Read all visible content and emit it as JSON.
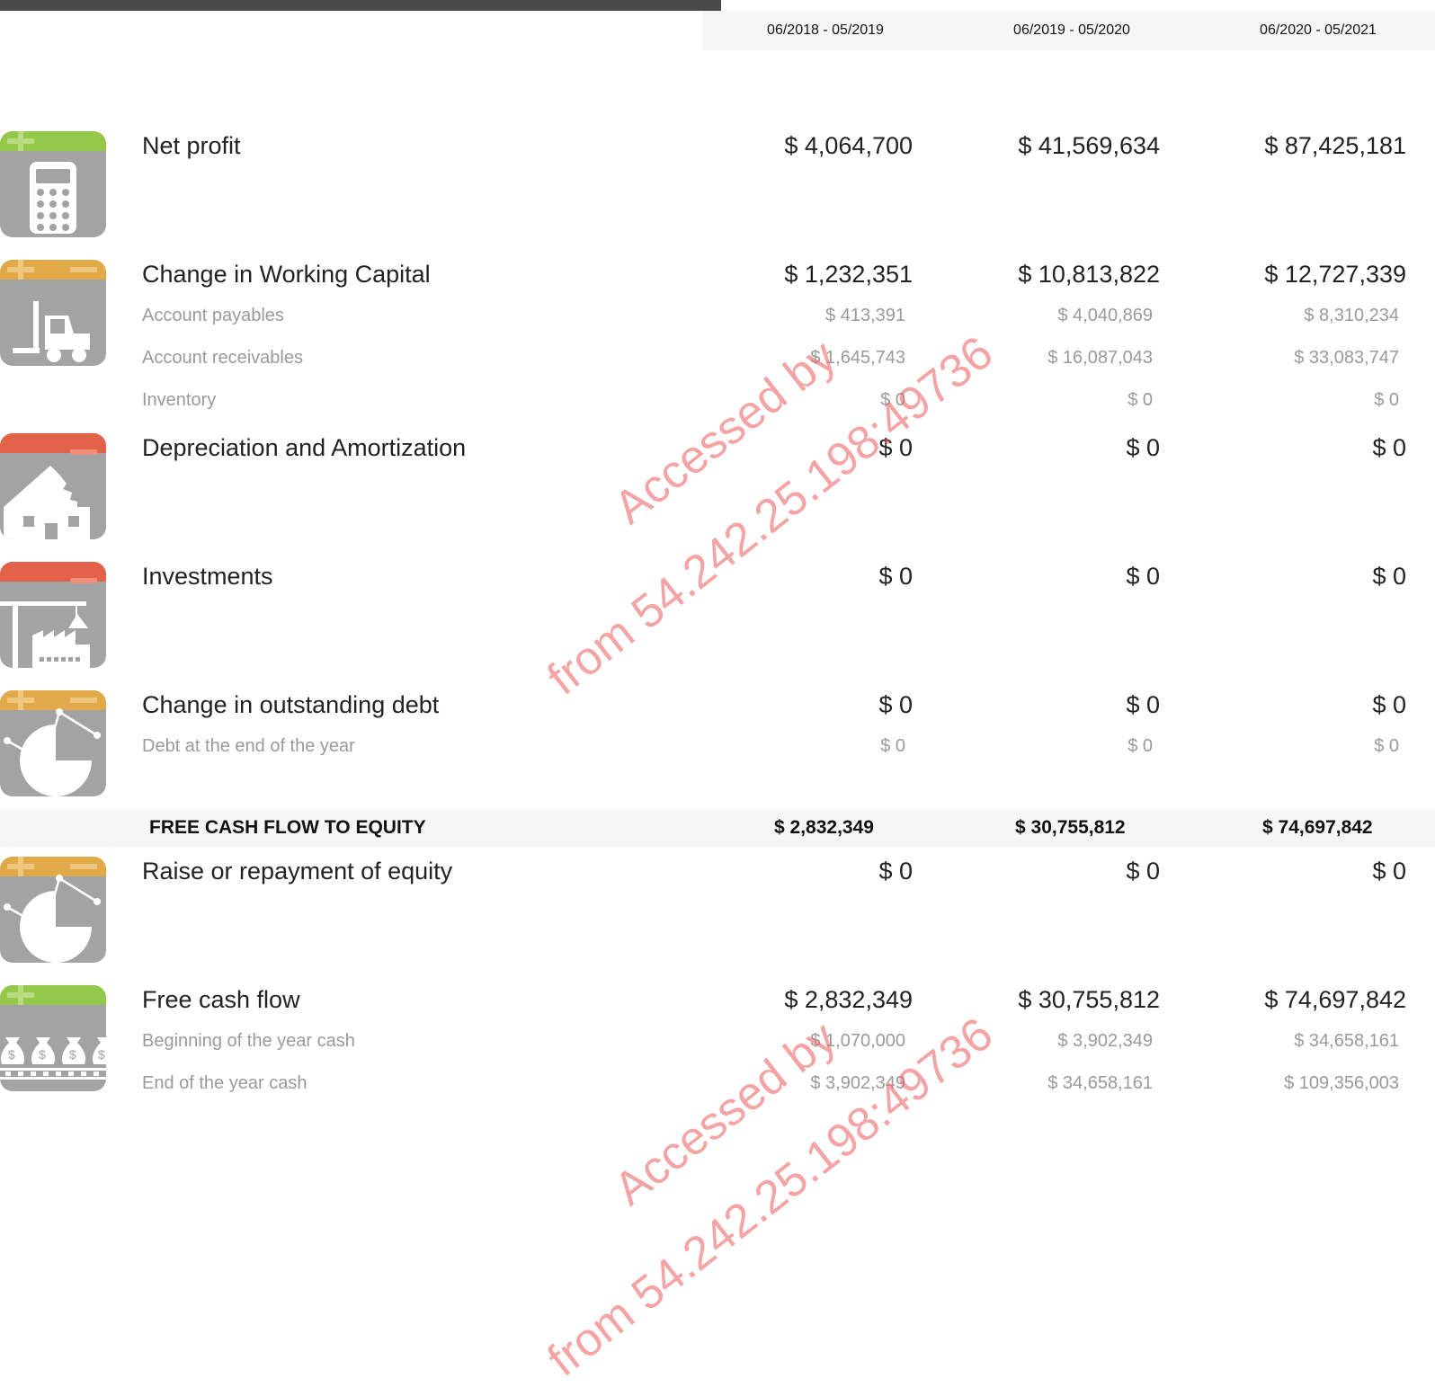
{
  "periods": [
    "06/2018 - 05/2019",
    "06/2019 - 05/2020",
    "06/2020 - 05/2021"
  ],
  "rows": {
    "net_profit": {
      "label": "Net profit",
      "values": [
        "$ 4,064,700",
        "$ 41,569,634",
        "$ 87,425,181"
      ]
    },
    "working_capital": {
      "label": "Change in Working Capital",
      "values": [
        "$ 1,232,351",
        "$ 10,813,822",
        "$ 12,727,339"
      ],
      "sub": [
        {
          "label": "Account payables",
          "values": [
            "$ 413,391",
            "$ 4,040,869",
            "$ 8,310,234"
          ]
        },
        {
          "label": "Account receivables",
          "values": [
            "$ 1,645,743",
            "$ 16,087,043",
            "$ 33,083,747"
          ]
        },
        {
          "label": "Inventory",
          "values": [
            "$ 0",
            "$ 0",
            "$ 0"
          ]
        }
      ]
    },
    "depreciation": {
      "label": "Depreciation and Amortization",
      "values": [
        "$ 0",
        "$ 0",
        "$ 0"
      ]
    },
    "investments": {
      "label": "Investments",
      "values": [
        "$ 0",
        "$ 0",
        "$ 0"
      ]
    },
    "debt": {
      "label": "Change in outstanding debt",
      "values": [
        "$ 0",
        "$ 0",
        "$ 0"
      ],
      "sub": [
        {
          "label": "Debt at the end of the year",
          "values": [
            "$ 0",
            "$ 0",
            "$ 0"
          ]
        }
      ]
    },
    "fcfe": {
      "label": "FREE CASH FLOW TO EQUITY",
      "values": [
        "$ 2,832,349",
        "$ 30,755,812",
        "$ 74,697,842"
      ]
    },
    "equity": {
      "label": "Raise or repayment of equity",
      "values": [
        "$ 0",
        "$ 0",
        "$ 0"
      ]
    },
    "free_cash_flow": {
      "label": "Free cash flow",
      "values": [
        "$ 2,832,349",
        "$ 30,755,812",
        "$ 74,697,842"
      ],
      "sub": [
        {
          "label": "Beginning of the year cash",
          "values": [
            "$ 1,070,000",
            "$ 3,902,349",
            "$ 34,658,161"
          ]
        },
        {
          "label": "End of the year cash",
          "values": [
            "$ 3,902,349",
            "$ 34,658,161",
            "$ 109,356,003"
          ]
        }
      ]
    }
  },
  "watermark": {
    "line1": "Accessed by",
    "line2": "from 54.242.25.198:49736"
  },
  "icons": {
    "net_profit": "calculator-icon",
    "working_capital": "forklift-icon",
    "depreciation": "damaged-house-icon",
    "investments": "crane-factory-icon",
    "debt": "pie-chart-icon",
    "equity": "pie-chart-icon",
    "free_cash_flow": "money-bags-icon"
  },
  "colors": {
    "green": "#93c84a",
    "orange": "#e2a94a",
    "red": "#e2624a",
    "icon_gray": "#a3a3a3"
  }
}
